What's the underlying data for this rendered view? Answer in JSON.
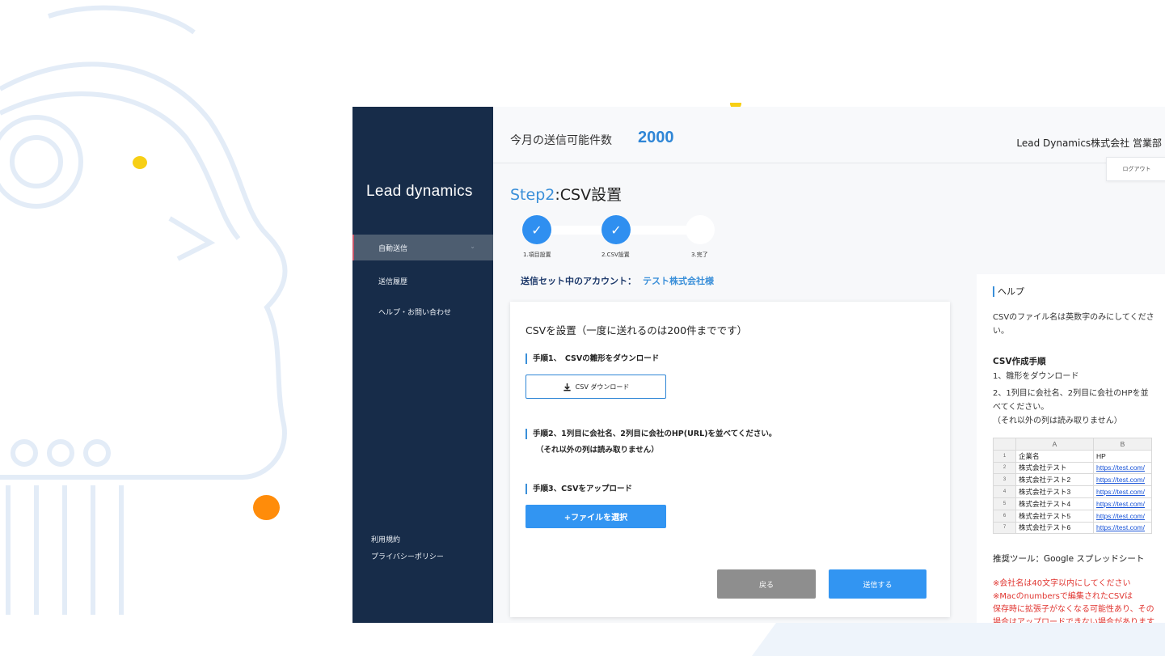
{
  "app": {
    "brand": "Lead dynamics",
    "quota_label": "今月の送信可能件数",
    "quota_value": "2000",
    "company": "Lead Dynamics株式会社 営業部",
    "logout_label": "ログアウト"
  },
  "sidebar": {
    "items": [
      {
        "label": "自動送信",
        "active": true
      },
      {
        "label": "送信履歴"
      },
      {
        "label": "ヘルプ・お問い合わせ"
      }
    ],
    "footer": {
      "terms": "利用規約",
      "privacy": "プライバシーポリシー"
    }
  },
  "page": {
    "step_prefix": "Step2",
    "step_title": ":CSV設置",
    "steps": [
      {
        "label": "1.項目設置",
        "done": true
      },
      {
        "label": "2.CSV設置",
        "done": true
      },
      {
        "label": "3.完了",
        "done": false
      }
    ],
    "account_label": "送信セット中のアカウント：",
    "account_name": "テスト株式会社様"
  },
  "card": {
    "title": "CSVを設置（一度に送れるのは200件までです）",
    "step1": "手順1、　CSVの雛形をダウンロード",
    "download_label": "CSV ダウンロード",
    "step2": "手順2、1列目に会社名、2列目に会社のHP(URL)を並べてください。",
    "step2_note": "（それ以外の列は読み取りません）",
    "step3": "手順3、CSVをアップロード",
    "upload_label": "+ファイルを選択",
    "back_label": "戻る",
    "submit_label": "送信する"
  },
  "help": {
    "title": "ヘルプ",
    "intro": "CSVのファイル名は英数字のみにしてください。",
    "howto_title": "CSV作成手順",
    "howto_1": "1、雛形をダウンロード",
    "howto_2": "2、1列目に会社名、2列目に会社のHPを並べてください。",
    "howto_note": "（それ以外の列は読み取りません）",
    "sheet": {
      "col_a": "A",
      "col_b": "B",
      "rows": [
        {
          "n": "1",
          "a": "企業名",
          "b": "HP"
        },
        {
          "n": "2",
          "a": "株式会社テスト",
          "b": "https://test.com/"
        },
        {
          "n": "3",
          "a": "株式会社テスト2",
          "b": "https://test.com/"
        },
        {
          "n": "4",
          "a": "株式会社テスト3",
          "b": "https://test.com/"
        },
        {
          "n": "5",
          "a": "株式会社テスト4",
          "b": "https://test.com/"
        },
        {
          "n": "6",
          "a": "株式会社テスト5",
          "b": "https://test.com/"
        },
        {
          "n": "7",
          "a": "株式会社テスト6",
          "b": "https://test.com/"
        }
      ]
    },
    "tool": "推奨ツール：Google スプレッドシート",
    "warn_1": "※会社名は40文字以内にしてください",
    "warn_2": "※Macのnumbersで編集されたCSVは",
    "warn_3": "保存時に拡張子がなくなる可能性あり、その",
    "warn_4": "場合はアップロードできない場合があります"
  }
}
